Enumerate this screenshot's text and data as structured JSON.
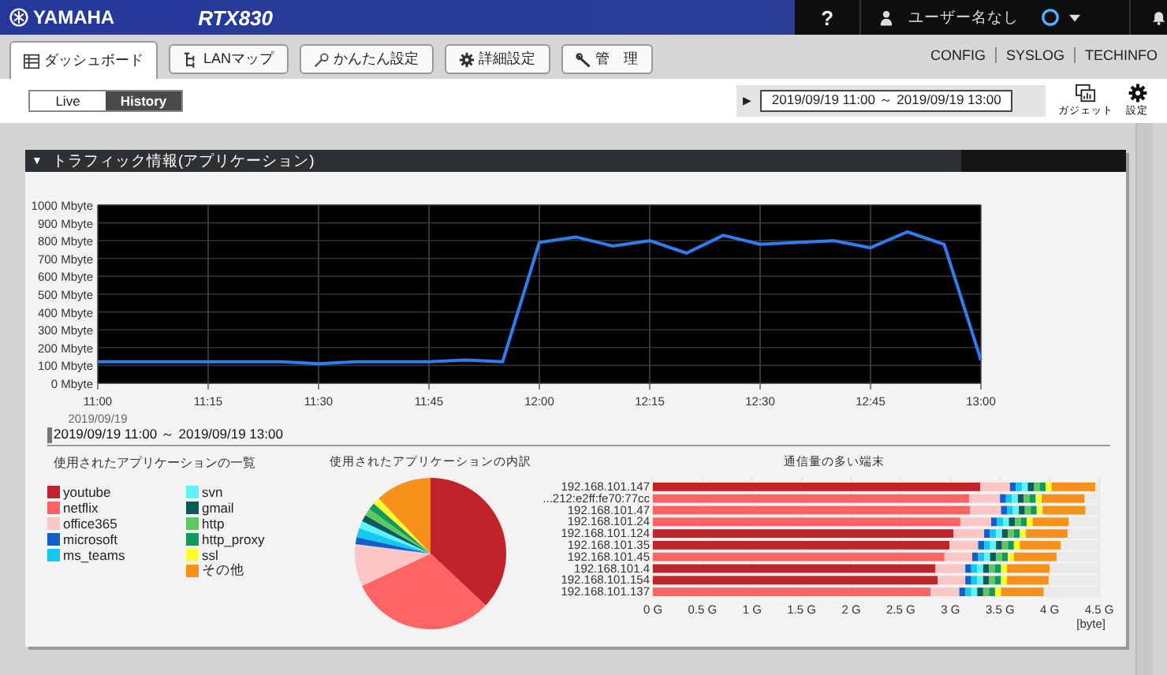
{
  "header": {
    "brand": "YAMAHA",
    "model": "RTX830",
    "help": "?",
    "user": "ユーザー名なし"
  },
  "tabs": [
    {
      "label": "ダッシュボード",
      "kind": "dashboard",
      "selected": true
    },
    {
      "label": "LANマップ",
      "kind": "map",
      "selected": false
    },
    {
      "label": "かんたん設定",
      "kind": "wand",
      "selected": false
    },
    {
      "label": "詳細設定",
      "kind": "gear",
      "selected": false
    },
    {
      "label": "管　理",
      "kind": "wrench",
      "selected": false
    }
  ],
  "links": [
    "CONFIG",
    "SYSLOG",
    "TECHINFO"
  ],
  "mode_toggle": [
    {
      "label": "Live",
      "selected": false
    },
    {
      "label": "History",
      "selected": true
    }
  ],
  "period": {
    "play": "▶",
    "value": "2019/09/19 11:00 ～ 2019/09/19 13:00"
  },
  "tools": [
    {
      "kind": "gadget",
      "label": "ガジェット"
    },
    {
      "kind": "settings",
      "label": "設定"
    }
  ],
  "panel": {
    "toggle": "▼",
    "title": "トラフィック情報(アプリケーション)",
    "traffic_chart": {
      "chart_data": {
        "type": "line",
        "grid": true,
        "ylim": [
          0,
          1000
        ],
        "categories": [
          "11:00",
          null,
          null,
          "11:15",
          null,
          null,
          "11:30",
          null,
          null,
          "11:45",
          null,
          null,
          "12:00",
          null,
          null,
          "12:15",
          null,
          null,
          "12:30",
          null,
          null,
          "12:45",
          null,
          null,
          "13:00"
        ],
        "yticks": [
          {
            "value": 0,
            "label": "0 Mbyte"
          },
          {
            "value": 100,
            "label": "100 Mbyte"
          },
          {
            "value": 200,
            "label": "200 Mbyte"
          },
          {
            "value": 300,
            "label": "300 Mbyte"
          },
          {
            "value": 400,
            "label": "400 Mbyte"
          },
          {
            "value": 500,
            "label": "500 Mbyte"
          },
          {
            "value": 600,
            "label": "600 Mbyte"
          },
          {
            "value": 700,
            "label": "700 Mbyte"
          },
          {
            "value": 800,
            "label": "800 Mbyte"
          },
          {
            "value": 900,
            "label": "900 Mbyte"
          },
          {
            "value": 1000,
            "label": "1000 Mbyte"
          }
        ],
        "series": [
          {
            "color": "#2f7df0",
            "values": [
              120,
              120,
              120,
              120,
              120,
              120,
              110,
              120,
              120,
              120,
              130,
              120,
              790,
              820,
              770,
              800,
              730,
              830,
              780,
              790,
              800,
              760,
              850,
              780,
              130
            ]
          }
        ]
      },
      "date_label": "2019/09/19",
      "range_label": "2019/09/19 11:00 ～ 2019/09/19 13:00"
    },
    "app_list": {
      "title": "使用されたアプリケーションの一覧"
    },
    "breakdown": {
      "title": "使用されたアプリケーションの内訳"
    },
    "top_hosts": {
      "chart_data": {
        "type": "bar",
        "title": "通信量の多い端末",
        "orientation": "horizontal",
        "stacked": true,
        "grid": true,
        "xlabel": "[byte]",
        "xlim": [
          0,
          4.5
        ],
        "xticks": [
          {
            "value": 0,
            "label": "0 G"
          },
          {
            "value": 0.5,
            "label": "0.5 G"
          },
          {
            "value": 1,
            "label": "1 G"
          },
          {
            "value": 1.5,
            "label": "1.5 G"
          },
          {
            "value": 2,
            "label": "2 G"
          },
          {
            "value": 2.5,
            "label": "2.5 G"
          },
          {
            "value": 3,
            "label": "3 G"
          },
          {
            "value": 3.5,
            "label": "3.5 G"
          },
          {
            "value": 4,
            "label": "4 G"
          },
          {
            "value": 4.5,
            "label": "4.5 G"
          }
        ],
        "categories": [
          "192.168.101.147",
          "...212:e2ff:fe70:77cc",
          "192.168.101.47",
          "192.168.101.24",
          "192.168.101.124",
          "192.168.101.35",
          "192.168.101.45",
          "192.168.101.4",
          "192.168.101.154",
          "192.168.101.137"
        ],
        "series": [
          {
            "name": "youtube",
            "color": "#c1232b",
            "values": [
              3.3,
              0,
              0,
              0,
              3.03,
              2.99,
              0,
              2.85,
              2.87,
              0
            ]
          },
          {
            "name": "netflix",
            "color": "#fe6464",
            "values": [
              0,
              3.19,
              3.2,
              3.1,
              0,
              0,
              2.94,
              0,
              0,
              2.8
            ]
          },
          {
            "name": "office365",
            "color": "#fcc6c6",
            "values": [
              0.3,
              0.31,
              0.31,
              0.31,
              0.31,
              0.29,
              0.28,
              0.3,
              0.28,
              0.29
            ]
          },
          {
            "name": "microsoft",
            "color": "#0f5fcc",
            "values": [
              0.06,
              0.06,
              0.06,
              0.06,
              0.06,
              0.06,
              0.06,
              0.06,
              0.06,
              0.06
            ]
          },
          {
            "name": "ms_teams",
            "color": "#14c8f4",
            "values": [
              0.06,
              0.06,
              0.06,
              0.06,
              0.06,
              0.06,
              0.06,
              0.06,
              0.06,
              0.06
            ]
          },
          {
            "name": "svn",
            "color": "#5ff4fc",
            "values": [
              0.06,
              0.06,
              0.06,
              0.06,
              0.06,
              0.06,
              0.06,
              0.06,
              0.06,
              0.06
            ]
          },
          {
            "name": "gmail",
            "color": "#0c5a5a",
            "values": [
              0.06,
              0.06,
              0.06,
              0.06,
              0.06,
              0.06,
              0.06,
              0.06,
              0.06,
              0.06
            ]
          },
          {
            "name": "http",
            "color": "#5ec860",
            "values": [
              0.06,
              0.06,
              0.06,
              0.06,
              0.06,
              0.06,
              0.06,
              0.06,
              0.06,
              0.06
            ]
          },
          {
            "name": "http_proxy",
            "color": "#0e9a5c",
            "values": [
              0.06,
              0.06,
              0.06,
              0.06,
              0.06,
              0.06,
              0.06,
              0.06,
              0.06,
              0.06
            ]
          },
          {
            "name": "ssl",
            "color": "#fefc2a",
            "values": [
              0.06,
              0.06,
              0.06,
              0.06,
              0.06,
              0.06,
              0.06,
              0.06,
              0.06,
              0.06
            ]
          },
          {
            "name": "その他",
            "color": "#f79119",
            "values": [
              0.44,
              0.43,
              0.43,
              0.36,
              0.42,
              0.41,
              0.43,
              0.43,
              0.42,
              0.43
            ]
          }
        ]
      }
    }
  }
}
